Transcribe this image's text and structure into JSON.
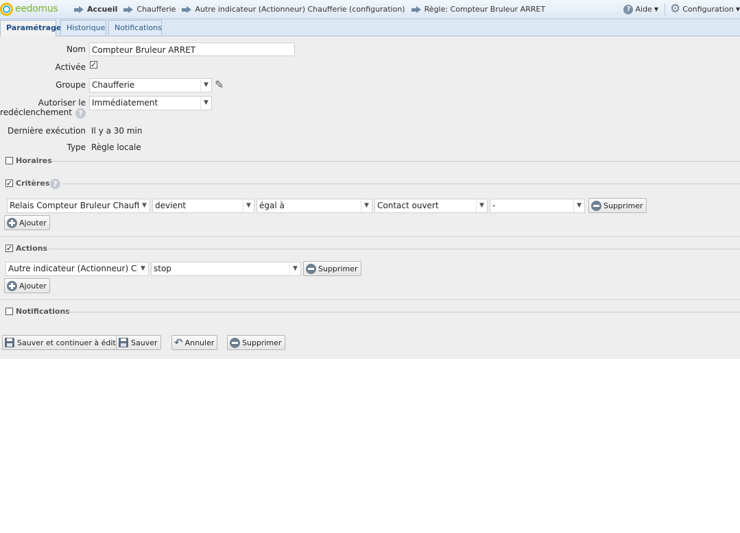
{
  "brand": {
    "logo_text": "eedomus"
  },
  "breadcrumb": [
    {
      "label": "Accueil",
      "bold": true
    },
    {
      "label": "Chaufferie"
    },
    {
      "label": "Autre indicateur (Actionneur) Chaufferie (configuration)"
    },
    {
      "label": "Règle: Compteur Bruleur ARRET"
    }
  ],
  "topright": {
    "help_label": "Aide",
    "config_label": "Configuration"
  },
  "tabs": [
    {
      "label": "Paramétrage",
      "active": true
    },
    {
      "label": "Historique"
    },
    {
      "label": "Notifications"
    }
  ],
  "form": {
    "name_label": "Nom",
    "name_value": "Compteur Bruleur ARRET",
    "active_label": "Activée",
    "active_checked": true,
    "group_label": "Groupe",
    "group_value": "Chaufferie",
    "retrigger_label_1": "Autoriser le",
    "retrigger_label_2": "redéclenchement",
    "retrigger_value": "Immédiatement",
    "last_exec_label": "Dernière exécution",
    "last_exec_value": "Il y a 30 min",
    "type_label": "Type",
    "type_value": "Règle locale"
  },
  "sections": {
    "schedules": {
      "title": "Horaires",
      "checked": false
    },
    "criteria": {
      "title": "Critères",
      "checked": true
    },
    "actions": {
      "title": "Actions",
      "checked": true
    },
    "notifications": {
      "title": "Notifications",
      "checked": false
    }
  },
  "criteria_row": {
    "device": "Relais Compteur Bruleur Chaufferie",
    "trigger": "devient",
    "operator": "égal à",
    "value": "Contact ouvert",
    "extra": "-",
    "delete_label": "Supprimer"
  },
  "actions_row": {
    "device": "Autre indicateur (Actionneur) Chaufferie",
    "value": "stop",
    "delete_label": "Supprimer"
  },
  "add_label": "Ajouter",
  "footer": {
    "save_continue_label": "Sauver et continuer à éditer",
    "save_label": "Sauver",
    "cancel_label": "Annuler",
    "delete_label": "Supprimer"
  }
}
